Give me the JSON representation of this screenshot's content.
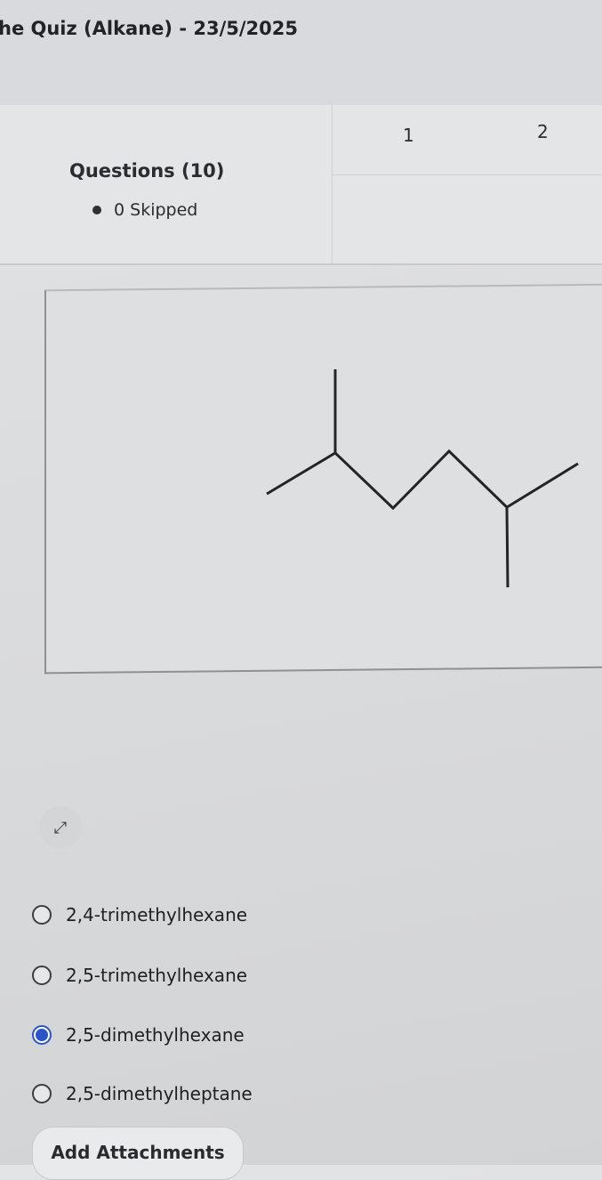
{
  "header": {
    "title": "he Quiz (Alkane) - 23/5/2025"
  },
  "summary": {
    "heading": "Questions (10)",
    "skipped": "0 Skipped"
  },
  "question_nav": {
    "numbers": [
      "1",
      "2"
    ]
  },
  "question": {
    "image": "skeletal-structure-2,5-dimethylhexane",
    "expand_icon": "expand-arrows-icon"
  },
  "options": [
    {
      "label": "2,4-trimethylhexane",
      "selected": false
    },
    {
      "label": "2,5-trimethylhexane",
      "selected": false
    },
    {
      "label": "2,5-dimethylhexane",
      "selected": true
    },
    {
      "label": "2,5-dimethylheptane",
      "selected": false
    }
  ],
  "actions": {
    "add_attachments": "Add Attachments"
  },
  "colors": {
    "accent": "#2a55c9",
    "text": "#2b2c30",
    "background": "#dcdddf"
  }
}
